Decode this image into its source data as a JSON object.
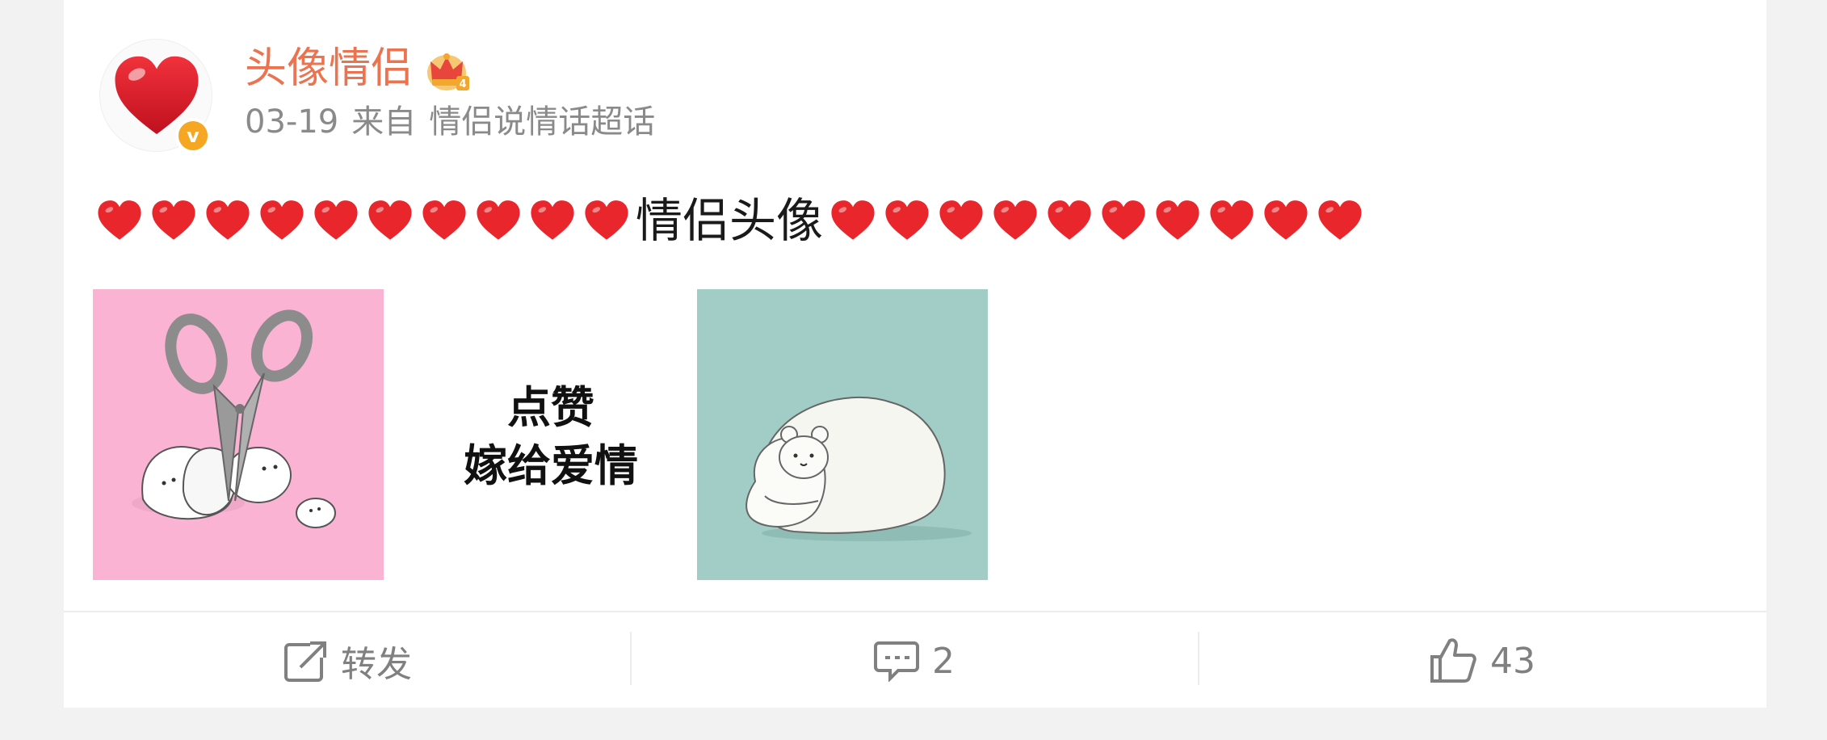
{
  "post": {
    "username": "头像情侣",
    "date": "03-19",
    "source_prefix": "来自",
    "source": "情侣说情话超话",
    "text_label": "情侣头像",
    "hearts_before": 10,
    "hearts_after": 10,
    "image_caption_line1": "点赞",
    "image_caption_line2": "嫁给爱情"
  },
  "actions": {
    "repost_label": "转发",
    "comment_count": "2",
    "like_count": "43"
  },
  "icons": {
    "verified": "v-verified-icon",
    "crown": "crown-icon",
    "repost": "share-square-icon",
    "comment": "comment-bubble-icon",
    "like": "thumbs-up-icon"
  },
  "colors": {
    "username": "#eb7350",
    "heart": "#e8262b",
    "verified": "#f5a623",
    "muted": "#808080"
  }
}
